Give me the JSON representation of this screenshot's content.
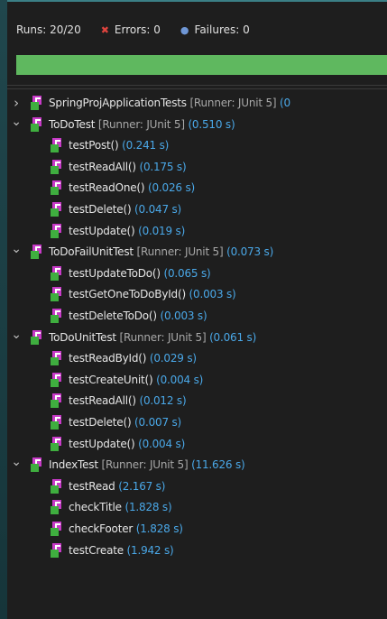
{
  "counters": {
    "runs": "Runs:  20/20",
    "errors": "Errors:  0",
    "failures": "Failures:  0"
  },
  "progress": {
    "fraction": 1.0,
    "color": "#5fb85f"
  },
  "tree": [
    {
      "name": "SpringProjApplicationTests",
      "runner": " [Runner: JUnit 5] ",
      "time": "(0",
      "expanded": false,
      "level": 0
    },
    {
      "name": "ToDoTest",
      "runner": " [Runner: JUnit 5] ",
      "time": "(0.510 s)",
      "expanded": true,
      "level": 0
    },
    {
      "name": "testPost()",
      "runner": "",
      "time": " (0.241 s)",
      "level": 1
    },
    {
      "name": "testReadAll()",
      "runner": "",
      "time": " (0.175 s)",
      "level": 1
    },
    {
      "name": "testReadOne()",
      "runner": "",
      "time": " (0.026 s)",
      "level": 1
    },
    {
      "name": "testDelete()",
      "runner": "",
      "time": " (0.047 s)",
      "level": 1
    },
    {
      "name": "testUpdate()",
      "runner": "",
      "time": " (0.019 s)",
      "level": 1
    },
    {
      "name": "ToDoFailUnitTest",
      "runner": " [Runner: JUnit 5] ",
      "time": "(0.073 s)",
      "expanded": true,
      "level": 0
    },
    {
      "name": "testUpdateToDo()",
      "runner": "",
      "time": " (0.065 s)",
      "level": 1
    },
    {
      "name": "testGetOneToDoById()",
      "runner": "",
      "time": " (0.003 s)",
      "level": 1
    },
    {
      "name": "testDeleteToDo()",
      "runner": "",
      "time": " (0.003 s)",
      "level": 1
    },
    {
      "name": "ToDoUnitTest",
      "runner": " [Runner: JUnit 5] ",
      "time": "(0.061 s)",
      "expanded": true,
      "level": 0
    },
    {
      "name": "testReadById()",
      "runner": "",
      "time": " (0.029 s)",
      "level": 1
    },
    {
      "name": "testCreateUnit()",
      "runner": "",
      "time": " (0.004 s)",
      "level": 1
    },
    {
      "name": "testReadAll()",
      "runner": "",
      "time": " (0.012 s)",
      "level": 1
    },
    {
      "name": "testDelete()",
      "runner": "",
      "time": " (0.007 s)",
      "level": 1
    },
    {
      "name": "testUpdate()",
      "runner": "",
      "time": " (0.004 s)",
      "level": 1
    },
    {
      "name": "IndexTest",
      "runner": " [Runner: JUnit 5] ",
      "time": "(11.626 s)",
      "expanded": true,
      "level": 0
    },
    {
      "name": "testRead",
      "runner": "",
      "time": " (2.167 s)",
      "level": 1
    },
    {
      "name": "checkTitle",
      "runner": "",
      "time": " (1.828 s)",
      "level": 1
    },
    {
      "name": "checkFooter",
      "runner": "",
      "time": " (1.828 s)",
      "level": 1
    },
    {
      "name": "testCreate",
      "runner": "",
      "time": " (1.942 s)",
      "level": 1
    }
  ],
  "icons": {
    "expand": "chevron-right-icon",
    "collapse": "chevron-down-icon"
  }
}
